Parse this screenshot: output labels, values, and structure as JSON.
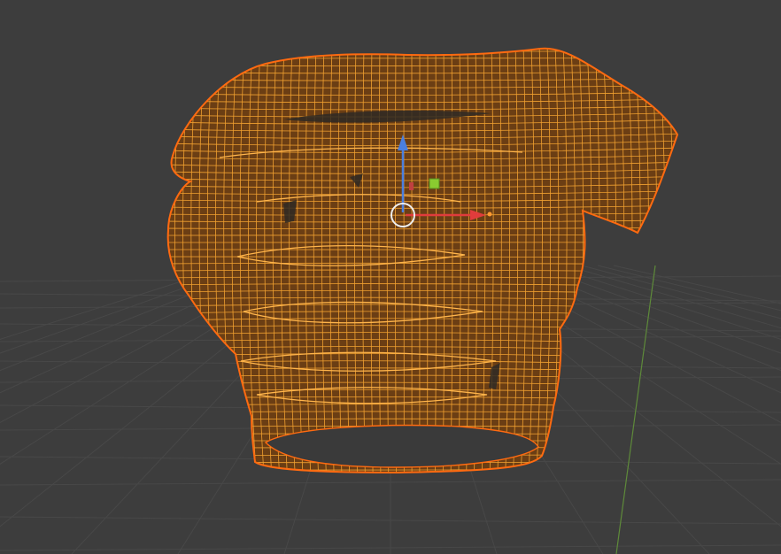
{
  "viewport": {
    "background": "#3d3d3d",
    "grid_color": "#484848",
    "y_axis_color": "#5e8a3a"
  },
  "mesh": {
    "object_type": "t-shirt",
    "display_mode": "wireframe",
    "selected": true,
    "fill_color": "#6b3e14",
    "wire_color": "#f0a030",
    "outline_color": "#ff6a10"
  },
  "gizmo": {
    "type": "move",
    "z_axis_color": "#4a7fe0",
    "x_axis_color": "#e03c3c",
    "plane_handle_color": "#8acb30",
    "origin_icon": "circle-pivot-icon"
  }
}
